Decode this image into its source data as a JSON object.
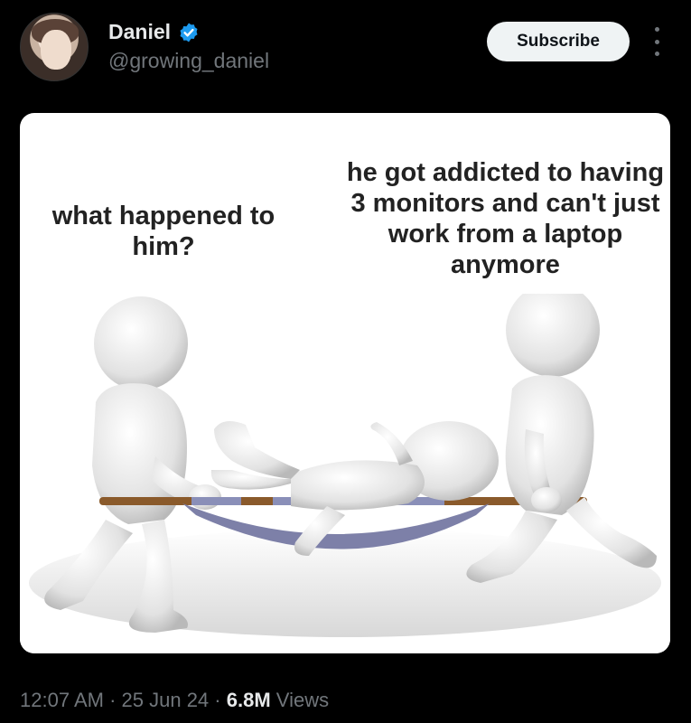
{
  "author": {
    "display_name": "Daniel",
    "handle": "@growing_daniel",
    "verified": true
  },
  "actions": {
    "subscribe_label": "Subscribe",
    "more_icon": "more-vertical-icon"
  },
  "media": {
    "caption_left": "what happened to him?",
    "caption_right": "he got addicted to having 3 monitors and can't just work from a laptop anymore"
  },
  "meta": {
    "time": "12:07 AM",
    "separator": "·",
    "date": "25 Jun 24",
    "views_count": "6.8M",
    "views_label": "Views"
  },
  "colors": {
    "background": "#000000",
    "verified_blue": "#1d9bf0",
    "subscribe_bg": "#eff3f4",
    "muted_text": "#71767b"
  }
}
